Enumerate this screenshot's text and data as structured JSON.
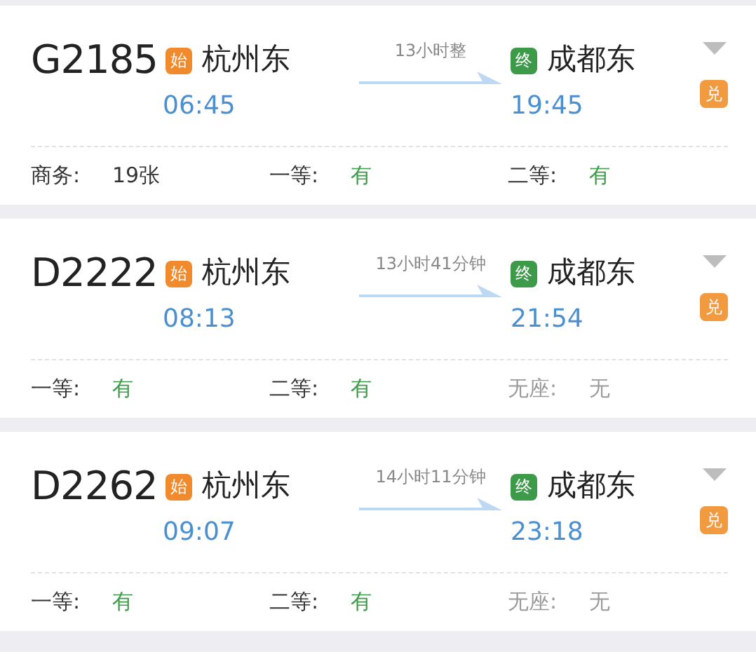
{
  "trains": [
    {
      "number": "G2185",
      "from_badge": "始",
      "from": "杭州东",
      "depart": "06:45",
      "duration": "13小时整",
      "to_badge": "终",
      "to": "成都东",
      "arrive": "19:45",
      "extra_badge": "兑",
      "seats": [
        {
          "label": "商务:",
          "value": "19张",
          "kind": "count"
        },
        {
          "label": "一等:",
          "value": "有",
          "kind": "available"
        },
        {
          "label": "二等:",
          "value": "有",
          "kind": "available"
        }
      ]
    },
    {
      "number": "D2222",
      "from_badge": "始",
      "from": "杭州东",
      "depart": "08:13",
      "duration": "13小时41分钟",
      "to_badge": "终",
      "to": "成都东",
      "arrive": "21:54",
      "extra_badge": "兑",
      "seats": [
        {
          "label": "一等:",
          "value": "有",
          "kind": "available"
        },
        {
          "label": "二等:",
          "value": "有",
          "kind": "available"
        },
        {
          "label": "无座:",
          "value": "无",
          "kind": "none"
        }
      ]
    },
    {
      "number": "D2262",
      "from_badge": "始",
      "from": "杭州东",
      "depart": "09:07",
      "duration": "14小时11分钟",
      "to_badge": "终",
      "to": "成都东",
      "arrive": "23:18",
      "extra_badge": "兑",
      "seats": [
        {
          "label": "一等:",
          "value": "有",
          "kind": "available"
        },
        {
          "label": "二等:",
          "value": "有",
          "kind": "available"
        },
        {
          "label": "无座:",
          "value": "无",
          "kind": "none"
        }
      ]
    }
  ]
}
